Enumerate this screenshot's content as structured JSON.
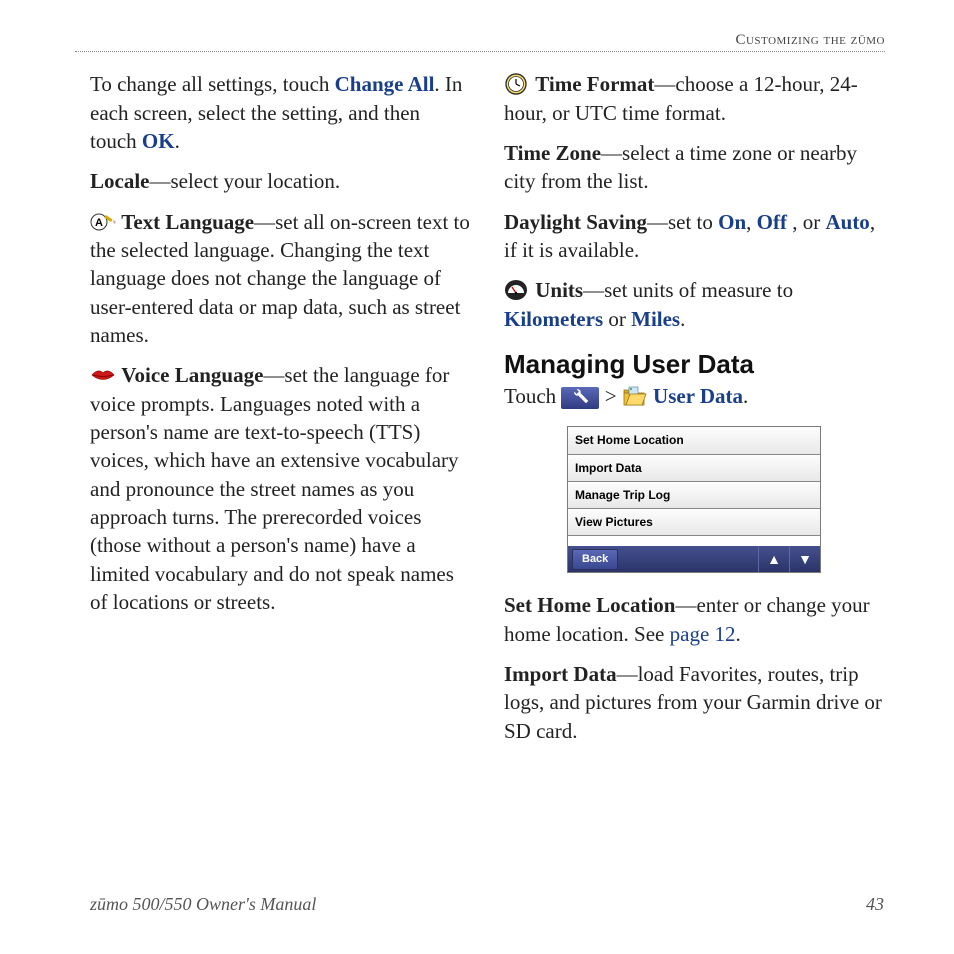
{
  "header": "Customizing the zūmo",
  "left": {
    "p1_a": "To change all settings, touch ",
    "p1_change_all": "Change All",
    "p1_b": ". In each screen, select the setting, and then touch ",
    "p1_ok": "OK",
    "p1_c": ".",
    "locale_label": "Locale",
    "locale_text": "—select your location.",
    "text_lang_label": "Text Language",
    "text_lang_text": "—set all on-screen text to the selected language. Changing the text language does not change the language of user-entered data or map data, such as street names.",
    "voice_lang_label": "Voice Language",
    "voice_lang_text": "—set the language for voice prompts. Languages noted with a person's name are text-to-speech (TTS) voices, which have an extensive vocabulary and pronounce the street names as you approach turns. The prerecorded voices (those without a person's name) have a limited vocabulary and do not speak names of locations or streets."
  },
  "right": {
    "time_format_label": "Time Format",
    "time_format_text": "—choose a 12-hour, 24-hour, or UTC time format.",
    "time_zone_label": "Time Zone",
    "time_zone_text": "—select a time zone or nearby city from the list.",
    "daylight_label": "Daylight Saving",
    "daylight_a": "—set to ",
    "daylight_on": "On",
    "daylight_sep1": ", ",
    "daylight_off": "Off",
    "daylight_sep2": " , or ",
    "daylight_auto": "Auto",
    "daylight_b": ", if it is available.",
    "units_label": "Units",
    "units_a": "—set units of measure to ",
    "units_km": "Kilometers",
    "units_or": " or ",
    "units_mi": "Miles",
    "units_b": ".",
    "heading": "Managing User Data",
    "touch_a": "Touch ",
    "touch_gt": " > ",
    "touch_userdata": "User Data",
    "touch_b": ".",
    "menu": {
      "items": [
        "Set Home Location",
        "Import Data",
        "Manage Trip Log",
        "View Pictures"
      ],
      "back": "Back"
    },
    "sethome_label": "Set Home Location",
    "sethome_a": "—enter or change your home location. See ",
    "sethome_page": "page 12",
    "sethome_b": ".",
    "import_label": "Import Data",
    "import_text": "—load Favorites, routes, trip logs, and pictures from your Garmin drive or SD card."
  },
  "footer": {
    "left": "zūmo 500/550 Owner's Manual",
    "right": "43"
  }
}
